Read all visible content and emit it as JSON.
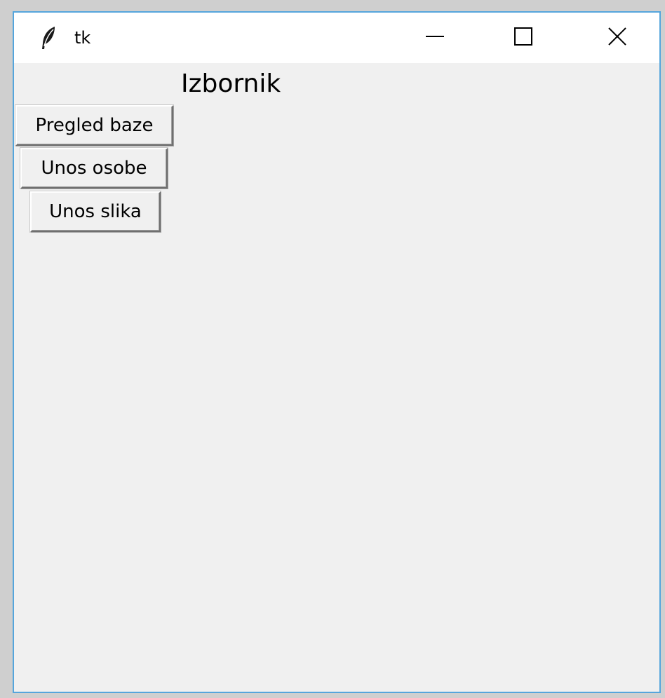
{
  "window": {
    "title": "tk",
    "controls": {
      "minimize_icon": "minimize-icon",
      "maximize_icon": "maximize-icon",
      "close_icon": "close-icon"
    },
    "border_color": "#55a5dc"
  },
  "content": {
    "heading": "Izbornik",
    "buttons": [
      {
        "label": "Pregled baze"
      },
      {
        "label": "Unos osobe"
      },
      {
        "label": "Unos slika"
      }
    ]
  }
}
